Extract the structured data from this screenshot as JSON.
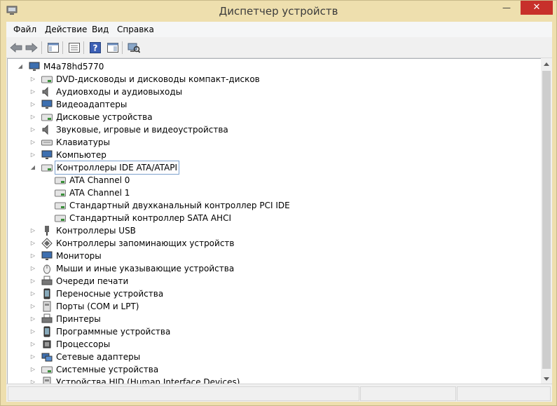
{
  "window": {
    "title": "Диспетчер устройств",
    "min": "—",
    "max": "□",
    "close": "✕"
  },
  "menu": {
    "file": "Файл",
    "action": "Действие",
    "view": "Вид",
    "help": "Справка"
  },
  "toolbar": {
    "buttons": [
      "back-icon",
      "forward-icon",
      "console-tree-icon",
      "properties-icon",
      "help-icon",
      "action-pane-icon",
      "scan-hardware-icon"
    ]
  },
  "tree": {
    "root": "M4a78hd5770",
    "items": [
      "DVD-дисководы и дисководы компакт-дисков",
      "Аудиовходы и аудиовыходы",
      "Видеоадаптеры",
      "Дисковые устройства",
      "Звуковые, игровые и видеоустройства",
      "Клавиатуры",
      "Компьютер",
      "Контроллеры IDE ATA/ATAPI",
      "Контроллеры USB",
      "Контроллеры запоминающих устройств",
      "Мониторы",
      "Мыши и иные указывающие устройства",
      "Очереди печати",
      "Переносные устройства",
      "Порты (COM и LPT)",
      "Принтеры",
      "Программные устройства",
      "Процессоры",
      "Сетевые адаптеры",
      "Системные устройства",
      "Устройства HID (Human Interface Devices)"
    ],
    "ide_children": [
      "ATA Channel 0",
      "ATA Channel 1",
      "Стандартный двухканальный контроллер PCI IDE",
      "Стандартный контроллер SATA AHCI"
    ]
  },
  "colors": {
    "frame": "#eedfae",
    "selection_border": "#7da2ce",
    "close": "#c7302b"
  }
}
